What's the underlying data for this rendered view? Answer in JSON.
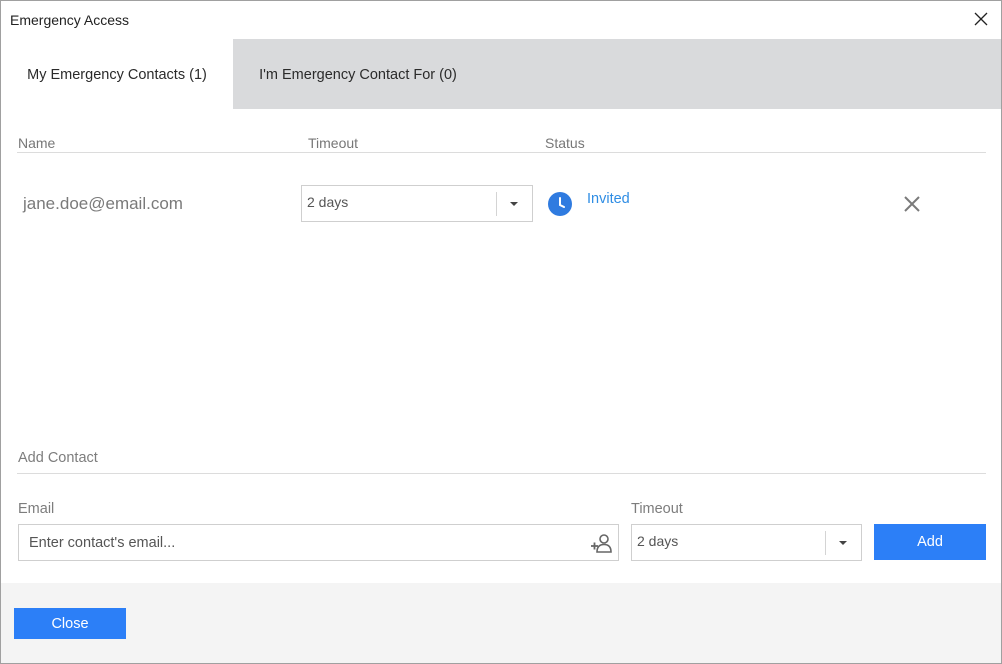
{
  "window": {
    "title": "Emergency Access"
  },
  "tabs": [
    {
      "label": "My Emergency Contacts (1)",
      "active": true
    },
    {
      "label": "I'm Emergency Contact For (0)",
      "active": false
    }
  ],
  "table": {
    "columns": [
      "Name",
      "Timeout",
      "Status"
    ],
    "rows": [
      {
        "name": "jane.doe@email.com",
        "timeout": "2 days",
        "status": "Invited",
        "status_icon": "clock-icon",
        "remove_icon": "close-icon"
      }
    ]
  },
  "add_contact": {
    "section_label": "Add Contact",
    "email_label": "Email",
    "email_placeholder": "Enter contact's email...",
    "email_value": "",
    "timeout_label": "Timeout",
    "timeout_value": "2 days",
    "add_label": "Add"
  },
  "footer": {
    "close_label": "Close"
  },
  "colors": {
    "accent": "#2c7ff7",
    "link": "#2f8de4",
    "tabbar_bg": "#d9dadc",
    "footer_bg": "#f4f4f4"
  }
}
